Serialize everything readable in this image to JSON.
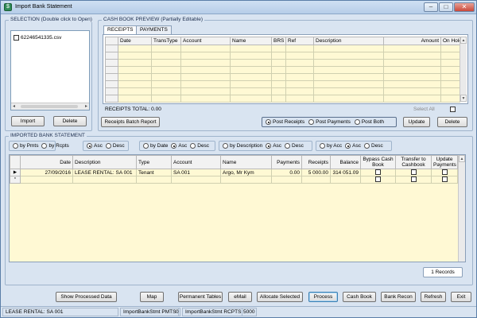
{
  "window": {
    "title": "Import Bank Statement",
    "controls": {
      "minimize": "–",
      "maximize": "□",
      "close": "✕"
    }
  },
  "selection": {
    "title": "SELECTION (Double click to Open)",
    "files": [
      "62246541335.csv"
    ],
    "import_label": "Import",
    "delete_label": "Delete"
  },
  "cashbook": {
    "title": "CASH BOOK PREVIEW (Partially Editable)",
    "tabs": [
      "RECEIPTS",
      "PAYMENTS"
    ],
    "columns": [
      "Date",
      "TransType",
      "Account",
      "Name",
      "BRS",
      "Ref",
      "Description",
      "Amount",
      "On Hold"
    ],
    "total_label": "RECEIPTS TOTAL: 0.00",
    "select_all_label": "Select All",
    "batch_report_label": "Receipts Batch Report",
    "post_options": [
      "Post Receipts",
      "Post Payments",
      "Post Both"
    ],
    "update_label": "Update",
    "delete_label": "Delete"
  },
  "imported": {
    "title": "IMPORTED BANK STATEMENT",
    "sort_groups": [
      {
        "options": [
          "by Pmts",
          "by Rcpts"
        ],
        "selected": -1
      },
      {
        "options": [
          "Asc",
          "Desc"
        ],
        "selected": 0
      },
      {
        "options": [
          "by Date",
          "Asc",
          "Desc"
        ],
        "selected": 1
      },
      {
        "options": [
          "by Description",
          "Asc",
          "Desc"
        ],
        "selected": 1
      },
      {
        "options": [
          "by Acc",
          "Asc",
          "Desc"
        ],
        "selected": 1
      }
    ],
    "columns": [
      "Date",
      "Description",
      "Type",
      "Account",
      "Name",
      "Payments",
      "Receipts",
      "Balance",
      "Bypass Cash Book",
      "Transfer to Cashbook",
      "Update Payments"
    ],
    "rows": [
      {
        "date": "27/09/2016",
        "description": "LEASE RENTAL: SA 001",
        "type": "Tenant",
        "account": "SA 001",
        "name": "Argo, Mr Kym",
        "payments": "0.00",
        "receipts": "5 000.00",
        "balance": "314 051.09"
      }
    ],
    "new_row_marker": "*",
    "current_row_marker": "▶",
    "records_label": "1 Records"
  },
  "bottom_buttons": {
    "show_processed": "Show Processed Data",
    "map": "Map",
    "permanent_tables": "Permanent Tables",
    "email": "eMail",
    "allocate_selected": "Allocate Selected",
    "process": "Process",
    "cash_book": "Cash Book",
    "bank_recon": "Bank Recon",
    "refresh": "Refresh",
    "exit": "Exit"
  },
  "statusbar": {
    "left": "LEASE RENTAL: SA 001",
    "pmts_label": "ImportBankStmt PMTS",
    "pmts_value": "0",
    "rcpts_label": "ImportBankStmt RCPTS",
    "rcpts_value": "5000"
  }
}
